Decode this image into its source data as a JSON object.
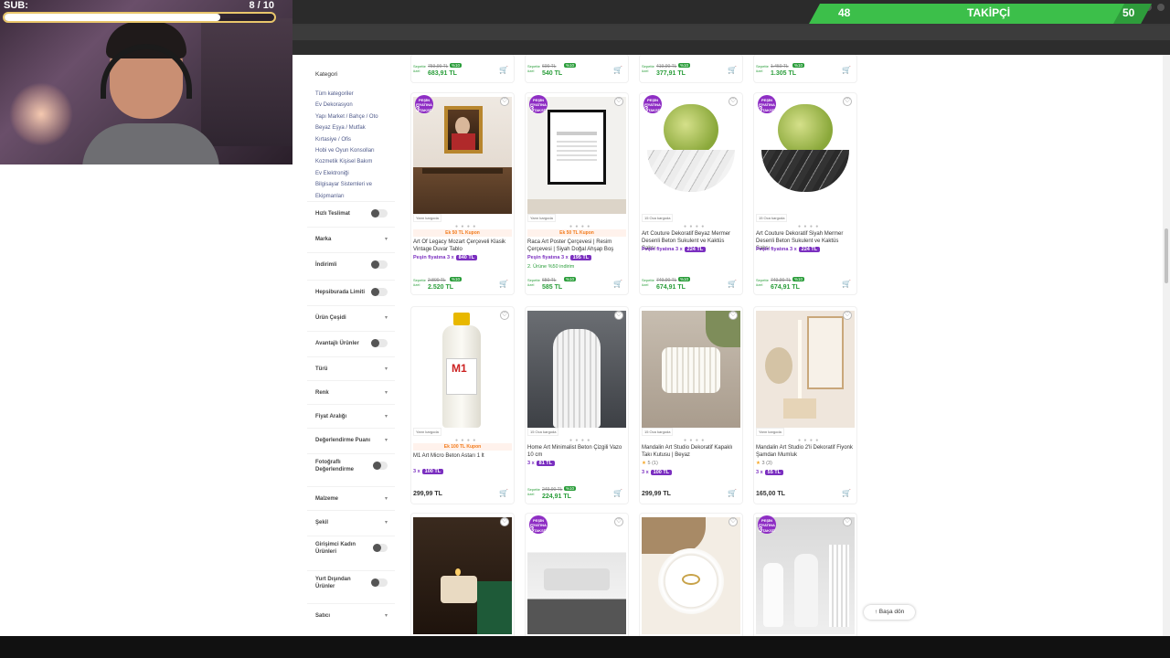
{
  "stream": {
    "sub_label": "SUB:",
    "sub_count": "8 / 10",
    "sub_progress": 0.8,
    "followers_current": "48",
    "followers_label": "TAKİPÇİ",
    "followers_goal": "50",
    "accent": "#3cbf4a"
  },
  "sidebar": {
    "heading": "Kategori",
    "categories": [
      "Tüm kategoriler",
      "Ev Dekorasyon",
      "Yapı Market / Bahçe / Oto",
      "Beyaz Eşya / Mutfak",
      "Kırtasiye / Ofis",
      "Hobi ve Oyun Konsolları",
      "Kozmetik Kişisel Bakım",
      "Ev Elektroniği",
      "Bilgisayar Sistemleri ve Ekipmanları"
    ],
    "facets": [
      {
        "label": "Hızlı Teslimat",
        "kind": "toggle"
      },
      {
        "label": "Marka",
        "kind": "chevron"
      },
      {
        "label": "İndirimli",
        "kind": "toggle"
      },
      {
        "label": "Hepsiburada Limiti",
        "kind": "toggle"
      },
      {
        "label": "Ürün Çeşidi",
        "kind": "chevron"
      },
      {
        "label": "Avantajlı Ürünler",
        "kind": "toggle"
      },
      {
        "label": "Türü",
        "kind": "chevron"
      },
      {
        "label": "Renk",
        "kind": "chevron"
      },
      {
        "label": "Fiyat Aralığı",
        "kind": "chevron"
      },
      {
        "label": "Değerlendirme Puanı",
        "kind": "chevron"
      },
      {
        "label": "Fotoğraflı Değerlendirme",
        "kind": "toggle"
      },
      {
        "label": "Malzeme",
        "kind": "chevron"
      },
      {
        "label": "Şekil",
        "kind": "chevron"
      },
      {
        "label": "Girişimci Kadın Ürünleri",
        "kind": "toggle"
      },
      {
        "label": "Yurt Dışından Ürünler",
        "kind": "toggle"
      },
      {
        "label": "Satıcı",
        "kind": "chevron"
      }
    ]
  },
  "top_row": [
    {
      "old": "759,99 TL",
      "disc": "%10",
      "new": "683,91 TL"
    },
    {
      "old": "600 TL",
      "disc": "%10",
      "new": "540 TL"
    },
    {
      "old": "419,90 TL",
      "disc": "%10",
      "new": "377,91 TL"
    },
    {
      "old": "1.450 TL",
      "disc": "%10",
      "new": "1.305 TL"
    }
  ],
  "basket_label": "Sepette özel",
  "badge_label": "PEŞİN FİYATINA",
  "badge_num": "3",
  "badge_suffix": "TAKSİT",
  "cards": [
    {
      "cargo": "Yarın kargoda",
      "coupon": "Ek 50 TL Kupon",
      "title": "Art Of Legacy Mozart Çerçeveli Klasik Vintage Duvar Tablo",
      "inst": "Peşin fiyatına 3 x",
      "pill": "840 TL",
      "old": "2.800 TL",
      "disc": "%10",
      "new": "2.520 TL",
      "img": "mozart"
    },
    {
      "cargo": "Yarın kargoda",
      "coupon": "Ek 50 TL Kupon",
      "title": "Raca Art Poster Çerçevesi | Resim Çerçevesi | Siyah Doğal Ahşap Boş",
      "inst": "Peşin fiyatına 3 x",
      "pill": "195 TL",
      "free": "2. Ürüne %50 indirim",
      "old": "650 TL",
      "disc": "%10",
      "new": "585 TL",
      "img": "frame"
    },
    {
      "cargo": "15 Oca kargoda",
      "title": "Art Couture Dekoratif Beyaz Mermer Desenli Beton Sukulent ve Kaktüs Saksı",
      "inst": "Peşin fiyatına 3 x",
      "pill": "224 TL",
      "old": "749,90 TL",
      "disc": "%10",
      "new": "674,91 TL",
      "img": "cactus-white"
    },
    {
      "cargo": "15 Oca kargoda",
      "title": "Art Couture Dekoratif Siyah Mermer Desenli Beton Sukulent ve Kaktüs Saksı",
      "inst": "Peşin fiyatına 3 x",
      "pill": "224 TL",
      "old": "749,90 TL",
      "disc": "%10",
      "new": "674,91 TL",
      "img": "cactus-black"
    },
    {
      "cargo": "Yarın kargoda",
      "coupon": "Ek 100 TL Kupon",
      "title": "M1 Art Micro Beton Astarı 1 lt",
      "inst": "3 x",
      "pill": "100 TL",
      "price": "299,99 TL",
      "img": "bottle"
    },
    {
      "cargo": "15 Oca kargoda",
      "title": "Home Art Minimalist Beton Çizgili Vazo 10 cm",
      "inst": "3 x",
      "pill": "81 TL",
      "old": "249,90 TL",
      "disc": "%10",
      "new": "224,91 TL",
      "img": "vase"
    },
    {
      "cargo": "15 Oca kargoda",
      "title": "Mandalin Art Studio Dekoratif Kapaklı Takı Kutusu | Beyaz",
      "rating": "5",
      "rcount": "(1)",
      "inst": "3 x",
      "pill": "100 TL",
      "price": "299,99 TL",
      "img": "box"
    },
    {
      "cargo": "Yarın kargoda",
      "title": "Mandalin Art Studio 2'li Dekoratif Fiyonk Şamdan Mumluk",
      "rating": "3",
      "rcount": "(3)",
      "inst": "3 x",
      "pill": "55 TL",
      "price": "165,00 TL",
      "img": "candle"
    },
    {
      "img": "candle-dark"
    },
    {
      "img": "sink",
      "badge": true
    },
    {
      "img": "tray"
    },
    {
      "img": "vases-white",
      "badge": true
    }
  ],
  "back_to_top": "Başa dön"
}
